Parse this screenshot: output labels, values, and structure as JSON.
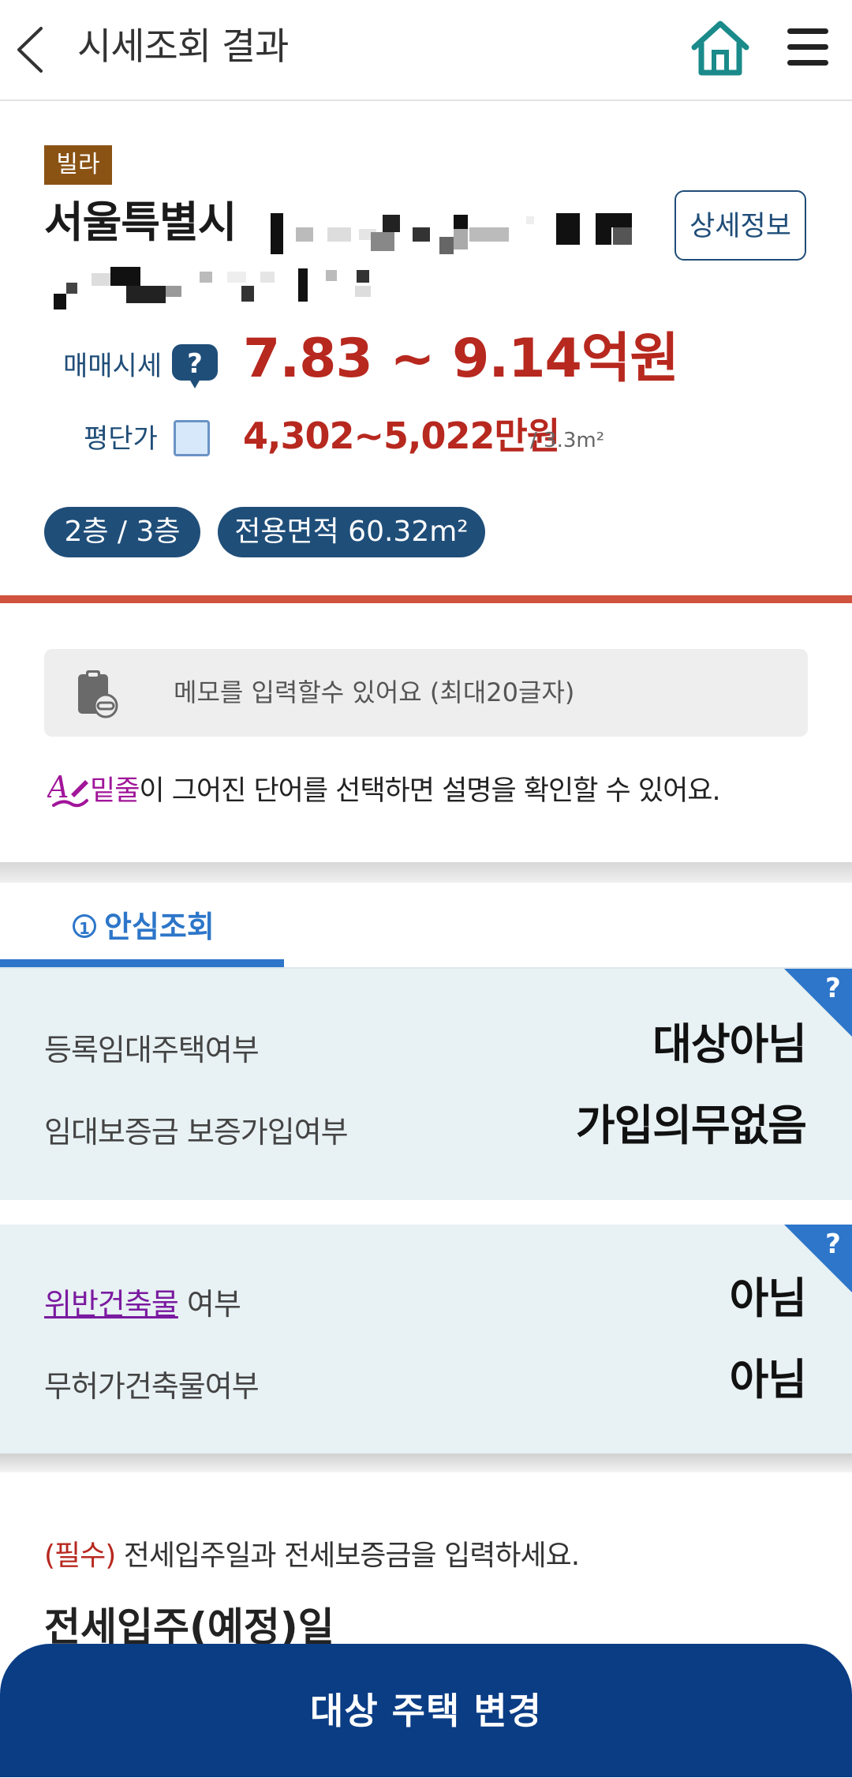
{
  "header": {
    "title": "시세조회 결과",
    "back_icon": "chevron-left-icon",
    "home_icon": "home-icon",
    "menu_icon": "hamburger-menu-icon",
    "home_color": "#1a8a8a"
  },
  "property": {
    "type_badge": "빌라",
    "address_main": "서울특별시",
    "detail_button": "상세정보",
    "price_label": "매매시세",
    "price_value": "7.83 ~ 9.14억원",
    "unit_price_label": "평단가",
    "unit_price_value": "4,302~5,022만원",
    "unit_price_suffix": "/ 3.3m²",
    "floor": "2층 / 3층",
    "area": "전용면적 60.32m²"
  },
  "memo": {
    "placeholder": "메모를 입력할수 있어요 (최대20글자)"
  },
  "hint": {
    "emphasis": "밑줄",
    "text": "이 그어진 단어를 선택하면 설명을 확인할 수 있어요."
  },
  "tab": {
    "number": "1",
    "label": "안심조회"
  },
  "panel1": {
    "rows": [
      {
        "label": "등록임대주택여부",
        "value": "대상아님"
      },
      {
        "label": "임대보증금 보증가입여부",
        "value": "가입의무없음"
      }
    ]
  },
  "panel2": {
    "rows": [
      {
        "label_link": "위반건축물",
        "label_rest": " 여부",
        "value": "아님"
      },
      {
        "label": "무허가건축물여부",
        "value": "아님"
      }
    ]
  },
  "form": {
    "required_tag": "(필수)",
    "required_text": " 전세입주일과 전세보증금을 입력하세요.",
    "date_label": "전세입주(예정)일"
  },
  "bottom_button": "대상 주택 변경",
  "colors": {
    "accent_navy": "#1f4e79",
    "price_red": "#b7281f",
    "tab_blue": "#2d76c9",
    "bottom_button": "#0b3d85",
    "badge_brown": "#8a5314"
  }
}
